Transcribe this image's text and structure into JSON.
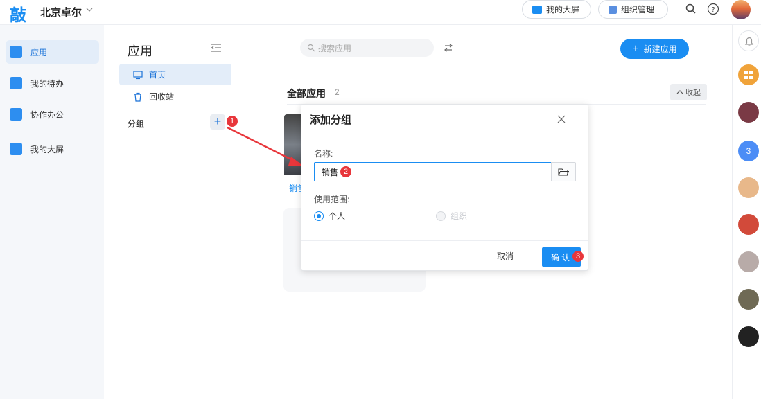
{
  "topbar": {
    "logo": "敲",
    "org_name": "北京卓尔",
    "btn_screen": "我的大屏",
    "btn_org": "组织管理"
  },
  "leftnav": {
    "items": [
      {
        "label": "应用",
        "active": true,
        "icon": "cube-icon"
      },
      {
        "label": "我的待办",
        "active": false,
        "icon": "todo-icon"
      },
      {
        "label": "协作办公",
        "active": false,
        "icon": "collab-icon"
      },
      {
        "label": "我的大屏",
        "active": false,
        "icon": "screen-icon"
      }
    ]
  },
  "col2": {
    "title": "应用",
    "items": [
      {
        "label": "首页",
        "icon": "monitor-icon",
        "active": true
      },
      {
        "label": "回收站",
        "icon": "trash-icon",
        "active": false
      }
    ],
    "group_label": "分组",
    "group_add": "+"
  },
  "main": {
    "search_placeholder": "搜索应用",
    "new_app": "新建应用",
    "section_title": "全部应用",
    "section_count": "2",
    "fold": "收起",
    "app_card_label": "销售"
  },
  "rightrail": {
    "count": "3"
  },
  "dialog": {
    "title": "添加分组",
    "name_label": "名称:",
    "name_value": "销售",
    "scope_label": "使用范围:",
    "scope_personal": "个人",
    "scope_org": "组织",
    "cancel": "取消",
    "confirm": "确认"
  },
  "badges": [
    "1",
    "2",
    "3"
  ],
  "colors": {
    "accent": "#1a8df2",
    "active_bg": "#e3edf9",
    "badge": "#e8363b"
  }
}
